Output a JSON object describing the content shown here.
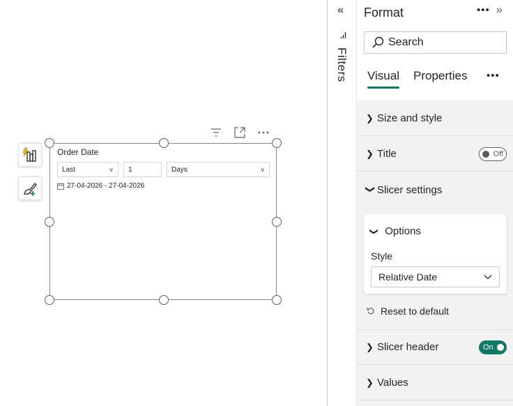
{
  "canvas": {
    "slicer": {
      "title": "Order Date",
      "period": "Last",
      "count": "1",
      "unit": "Days",
      "range": "27-04-2026 - 27-04-2026"
    },
    "header_icons": [
      "filter-icon",
      "focus-mode-icon",
      "more-options-icon"
    ],
    "side_tools": [
      "build-visual-icon",
      "format-visual-icon"
    ]
  },
  "filters": {
    "label": "Filters"
  },
  "format_pane": {
    "title": "Format",
    "search_placeholder": "Search",
    "tabs": [
      {
        "label": "Visual",
        "active": true
      },
      {
        "label": "Properties",
        "active": false
      }
    ],
    "sections": {
      "size_and_style": "Size and style",
      "title": "Title",
      "title_toggle": "Off",
      "slicer_settings": "Slicer settings",
      "options": "Options",
      "style_label": "Style",
      "style_value": "Relative Date",
      "reset": "Reset to default",
      "slicer_header": "Slicer header",
      "slicer_header_toggle": "On",
      "values": "Values"
    }
  },
  "colors": {
    "accent": "#117865",
    "pane_bg": "#f3f2f1",
    "border": "#8a8886",
    "text": "#252423"
  }
}
